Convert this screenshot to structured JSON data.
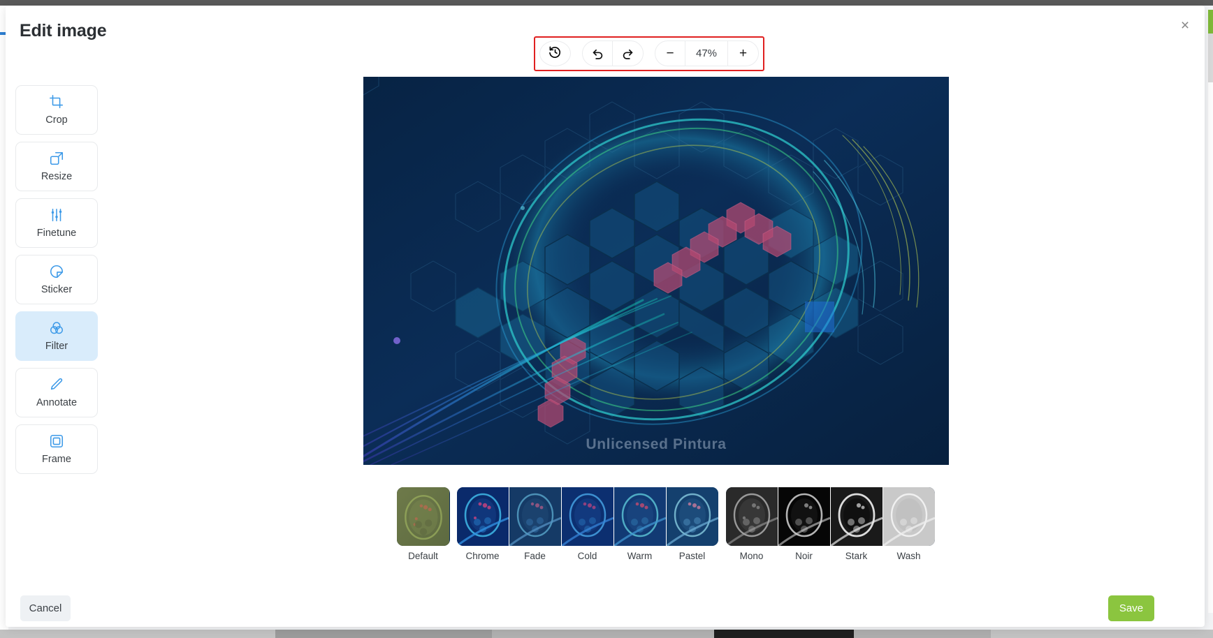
{
  "modal": {
    "title": "Edit image",
    "close_label": "×"
  },
  "tools": [
    {
      "label": "Crop",
      "icon": "crop-icon",
      "active": false
    },
    {
      "label": "Resize",
      "icon": "resize-icon",
      "active": false
    },
    {
      "label": "Finetune",
      "icon": "finetune-icon",
      "active": false
    },
    {
      "label": "Sticker",
      "icon": "sticker-icon",
      "active": false
    },
    {
      "label": "Filter",
      "icon": "filter-icon",
      "active": true
    },
    {
      "label": "Annotate",
      "icon": "annotate-icon",
      "active": false
    },
    {
      "label": "Frame",
      "icon": "frame-icon",
      "active": false
    }
  ],
  "toolbar": {
    "history_icon": "history-revert-icon",
    "undo_icon": "undo-icon",
    "redo_icon": "redo-icon",
    "zoom_out_label": "−",
    "zoom_value": "47%",
    "zoom_in_label": "+",
    "highlight_color": "#e02020"
  },
  "canvas": {
    "watermark": "Unlicensed Pintura"
  },
  "filters": {
    "groups": [
      {
        "name": "default-group",
        "items": [
          {
            "label": "Default",
            "id": "default"
          }
        ]
      },
      {
        "name": "color-group",
        "items": [
          {
            "label": "Chrome",
            "id": "chrome"
          },
          {
            "label": "Fade",
            "id": "fade"
          },
          {
            "label": "Cold",
            "id": "cold"
          },
          {
            "label": "Warm",
            "id": "warm"
          },
          {
            "label": "Pastel",
            "id": "pastel"
          }
        ]
      },
      {
        "name": "mono-group",
        "items": [
          {
            "label": "Mono",
            "id": "mono"
          },
          {
            "label": "Noir",
            "id": "noir"
          },
          {
            "label": "Stark",
            "id": "stark"
          },
          {
            "label": "Wash",
            "id": "wash"
          }
        ]
      }
    ]
  },
  "footer": {
    "cancel_label": "Cancel",
    "save_label": "Save",
    "save_color": "#8bc53f"
  }
}
